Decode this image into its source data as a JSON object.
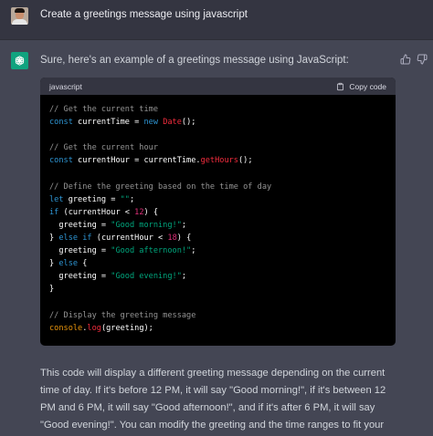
{
  "user": {
    "message": "Create a greetings message using javascript"
  },
  "assistant": {
    "intro": "Sure, here's an example of a greetings message using JavaScript:",
    "code": {
      "language": "javascript",
      "copy_label": "Copy code",
      "lines": [
        [
          {
            "t": "// Get the current time",
            "c": "com"
          }
        ],
        [
          {
            "t": "const",
            "c": "kw"
          },
          {
            "t": " currentTime = "
          },
          {
            "t": "new",
            "c": "kw"
          },
          {
            "t": " "
          },
          {
            "t": "Date",
            "c": "fn"
          },
          {
            "t": "();"
          }
        ],
        [],
        [
          {
            "t": "// Get the current hour",
            "c": "com"
          }
        ],
        [
          {
            "t": "const",
            "c": "kw"
          },
          {
            "t": " currentHour = currentTime."
          },
          {
            "t": "getHours",
            "c": "fn"
          },
          {
            "t": "();"
          }
        ],
        [],
        [
          {
            "t": "// Define the greeting based on the time of day",
            "c": "com"
          }
        ],
        [
          {
            "t": "let",
            "c": "kw"
          },
          {
            "t": " greeting = "
          },
          {
            "t": "\"\"",
            "c": "str"
          },
          {
            "t": ";"
          }
        ],
        [
          {
            "t": "if",
            "c": "kw"
          },
          {
            "t": " (currentHour < "
          },
          {
            "t": "12",
            "c": "num"
          },
          {
            "t": ") {"
          }
        ],
        [
          {
            "t": "  greeting = "
          },
          {
            "t": "\"Good morning!\"",
            "c": "str"
          },
          {
            "t": ";"
          }
        ],
        [
          {
            "t": "} "
          },
          {
            "t": "else",
            "c": "kw"
          },
          {
            "t": " "
          },
          {
            "t": "if",
            "c": "kw"
          },
          {
            "t": " (currentHour < "
          },
          {
            "t": "18",
            "c": "num"
          },
          {
            "t": ") {"
          }
        ],
        [
          {
            "t": "  greeting = "
          },
          {
            "t": "\"Good afternoon!\"",
            "c": "str"
          },
          {
            "t": ";"
          }
        ],
        [
          {
            "t": "} "
          },
          {
            "t": "else",
            "c": "kw"
          },
          {
            "t": " {"
          }
        ],
        [
          {
            "t": "  greeting = "
          },
          {
            "t": "\"Good evening!\"",
            "c": "str"
          },
          {
            "t": ";"
          }
        ],
        [
          {
            "t": "}"
          }
        ],
        [],
        [
          {
            "t": "// Display the greeting message",
            "c": "com"
          }
        ],
        [
          {
            "t": "console",
            "c": "cls"
          },
          {
            "t": "."
          },
          {
            "t": "log",
            "c": "fn"
          },
          {
            "t": "(greeting);"
          }
        ]
      ]
    },
    "explanation": "This code will display a different greeting message depending on the current time of day. If it's before 12 PM, it will say \"Good morning!\", if it's between 12 PM and 6 PM, it will say \"Good afternoon!\", and if it's after 6 PM, it will say \"Good evening!\". You can modify the greeting and the time ranges to fit your needs."
  },
  "icons": {
    "user_avatar": "user-photo-avatar",
    "assistant_avatar": "openai-logo-icon",
    "copy": "clipboard-icon",
    "thumbs_up": "thumbs-up-icon",
    "thumbs_down": "thumbs-down-icon"
  },
  "colors": {
    "page_bg": "#444654",
    "user_row_bg": "#343541",
    "assistant_avatar_bg": "#10a37f",
    "code_bg": "#000000",
    "code_header_bg": "#343541"
  }
}
